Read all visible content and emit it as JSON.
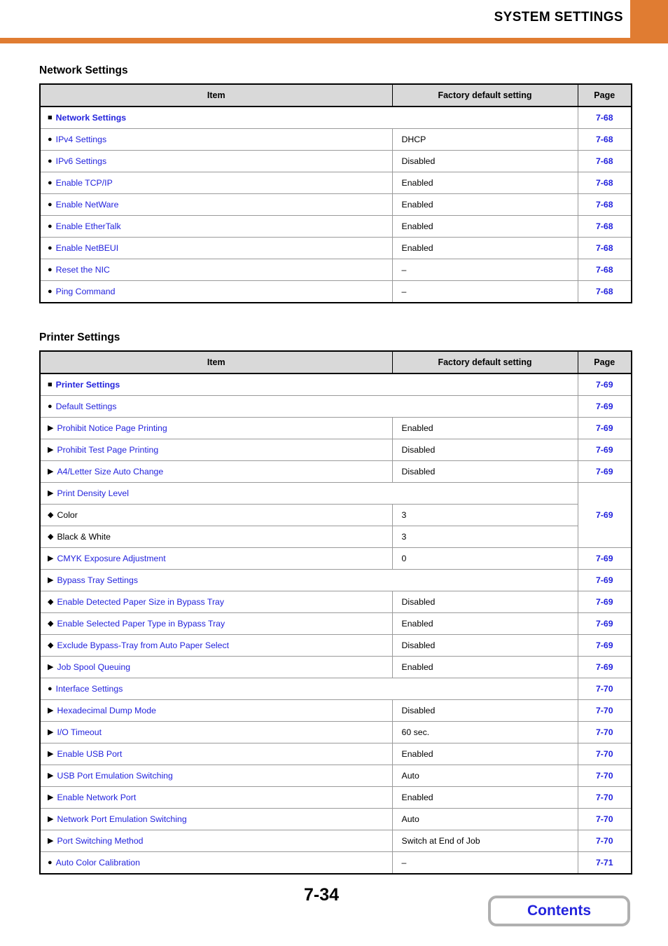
{
  "header": {
    "title": "SYSTEM SETTINGS",
    "accent_color": "#e07c32"
  },
  "link_color": "#2323dd",
  "sections": [
    {
      "title": "Network Settings",
      "columns": {
        "item": "Item",
        "value": "Factory default setting",
        "page": "Page"
      },
      "rows": [
        {
          "level": 0,
          "marker": "square",
          "label": "Network Settings",
          "link": true,
          "bold": true,
          "value": "",
          "page": "7-68"
        },
        {
          "level": 1,
          "marker": "circle",
          "label": "IPv4 Settings",
          "link": true,
          "bold": false,
          "value": "DHCP",
          "page": "7-68"
        },
        {
          "level": 1,
          "marker": "circle",
          "label": "IPv6 Settings",
          "link": true,
          "bold": false,
          "value": "Disabled",
          "page": "7-68"
        },
        {
          "level": 1,
          "marker": "circle",
          "label": "Enable TCP/IP",
          "link": true,
          "bold": false,
          "value": "Enabled",
          "page": "7-68"
        },
        {
          "level": 1,
          "marker": "circle",
          "label": "Enable NetWare",
          "link": true,
          "bold": false,
          "value": "Enabled",
          "page": "7-68"
        },
        {
          "level": 1,
          "marker": "circle",
          "label": "Enable EtherTalk",
          "link": true,
          "bold": false,
          "value": "Enabled",
          "page": "7-68"
        },
        {
          "level": 1,
          "marker": "circle",
          "label": "Enable NetBEUI",
          "link": true,
          "bold": false,
          "value": "Enabled",
          "page": "7-68"
        },
        {
          "level": 1,
          "marker": "circle",
          "label": "Reset the NIC",
          "link": true,
          "bold": false,
          "value": "–",
          "page": "7-68"
        },
        {
          "level": 1,
          "marker": "circle",
          "label": "Ping Command",
          "link": true,
          "bold": false,
          "value": "–",
          "page": "7-68"
        }
      ]
    },
    {
      "title": "Printer Settings",
      "columns": {
        "item": "Item",
        "value": "Factory default setting",
        "page": "Page"
      },
      "rows": [
        {
          "level": 0,
          "marker": "square",
          "label": "Printer Settings",
          "link": true,
          "bold": true,
          "value": "",
          "page": "7-69"
        },
        {
          "level": 1,
          "marker": "circle",
          "label": "Default Settings",
          "link": true,
          "bold": false,
          "value": "",
          "page": "7-69"
        },
        {
          "level": 2,
          "marker": "triangle",
          "label": "Prohibit Notice Page Printing",
          "link": true,
          "bold": false,
          "value": "Enabled",
          "page": "7-69"
        },
        {
          "level": 2,
          "marker": "triangle",
          "label": "Prohibit Test Page Printing",
          "link": true,
          "bold": false,
          "value": "Disabled",
          "page": "7-69"
        },
        {
          "level": 2,
          "marker": "triangle",
          "label": "A4/Letter Size Auto Change",
          "link": true,
          "bold": false,
          "value": "Disabled",
          "page": "7-69"
        },
        {
          "level": 2,
          "marker": "triangle",
          "label": "Print Density Level",
          "link": true,
          "bold": false,
          "value": "",
          "page": "7-69"
        },
        {
          "level": 3,
          "marker": "diamond",
          "label": "Color",
          "link": false,
          "bold": false,
          "value": "3",
          "page": ""
        },
        {
          "level": 3,
          "marker": "diamond",
          "label": "Black & White",
          "link": false,
          "bold": false,
          "value": "3",
          "page": ""
        },
        {
          "level": 2,
          "marker": "triangle",
          "label": "CMYK Exposure Adjustment",
          "link": true,
          "bold": false,
          "value": "0",
          "page": "7-69"
        },
        {
          "level": 2,
          "marker": "triangle",
          "label": "Bypass Tray Settings",
          "link": true,
          "bold": false,
          "value": "",
          "page": "7-69"
        },
        {
          "level": 3,
          "marker": "diamond",
          "label": "Enable Detected Paper Size in Bypass Tray",
          "link": true,
          "bold": false,
          "value": "Disabled",
          "page": "7-69"
        },
        {
          "level": 3,
          "marker": "diamond",
          "label": "Enable Selected Paper Type in Bypass Tray",
          "link": true,
          "bold": false,
          "value": "Enabled",
          "page": "7-69"
        },
        {
          "level": 3,
          "marker": "diamond",
          "label": "Exclude Bypass-Tray from Auto Paper Select",
          "link": true,
          "bold": false,
          "value": "Disabled",
          "page": "7-69"
        },
        {
          "level": 2,
          "marker": "triangle",
          "label": "Job Spool Queuing",
          "link": true,
          "bold": false,
          "value": "Enabled",
          "page": "7-69"
        },
        {
          "level": 1,
          "marker": "circle",
          "label": "Interface Settings",
          "link": true,
          "bold": false,
          "value": "",
          "page": "7-70"
        },
        {
          "level": 2,
          "marker": "triangle",
          "label": "Hexadecimal Dump Mode",
          "link": true,
          "bold": false,
          "value": "Disabled",
          "page": "7-70"
        },
        {
          "level": 2,
          "marker": "triangle",
          "label": "I/O Timeout",
          "link": true,
          "bold": false,
          "value": "60 sec.",
          "page": "7-70"
        },
        {
          "level": 2,
          "marker": "triangle",
          "label": "Enable USB Port",
          "link": true,
          "bold": false,
          "value": "Enabled",
          "page": "7-70"
        },
        {
          "level": 2,
          "marker": "triangle",
          "label": "USB Port Emulation Switching",
          "link": true,
          "bold": false,
          "value": "Auto",
          "page": "7-70"
        },
        {
          "level": 2,
          "marker": "triangle",
          "label": "Enable Network Port",
          "link": true,
          "bold": false,
          "value": "Enabled",
          "page": "7-70"
        },
        {
          "level": 2,
          "marker": "triangle",
          "label": "Network Port Emulation Switching",
          "link": true,
          "bold": false,
          "value": "Auto",
          "page": "7-70"
        },
        {
          "level": 2,
          "marker": "triangle",
          "label": "Port Switching Method",
          "link": true,
          "bold": false,
          "value": "Switch at End of Job",
          "page": "7-70"
        },
        {
          "level": 1,
          "marker": "circle",
          "label": "Auto Color Calibration",
          "link": true,
          "bold": false,
          "value": "–",
          "page": "7-71"
        }
      ]
    }
  ],
  "footer": {
    "page_number": "7-34",
    "contents_label": "Contents"
  }
}
